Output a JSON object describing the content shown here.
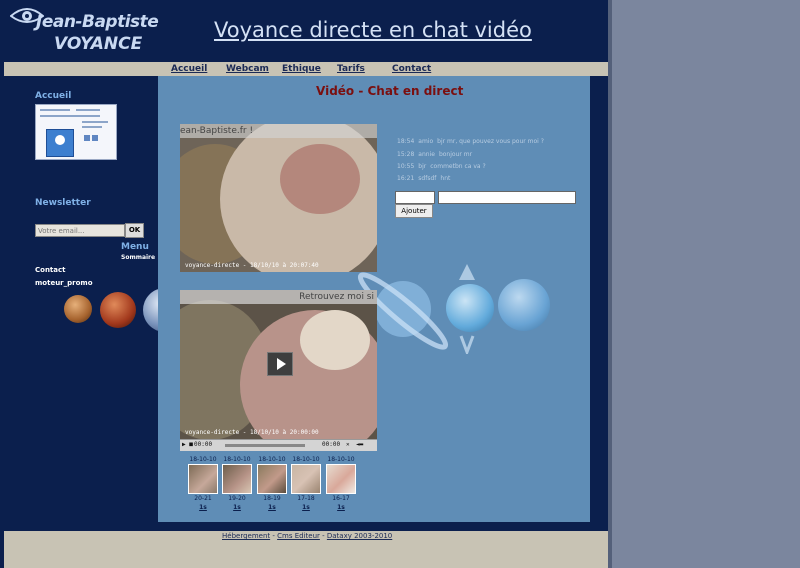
{
  "header": {
    "logo_name": "Jean-Baptiste",
    "logo_sub": "VOYANCE",
    "site_title": "Voyance directe en chat vidéo"
  },
  "nav": {
    "items": [
      "Accueil",
      "Webcam",
      "Ethique",
      "Tarifs",
      "Contact"
    ]
  },
  "left": {
    "accueil_title": "Accueil",
    "newsletter_title": "Newsletter",
    "email_placeholder": "Votre email...",
    "ok_label": "OK",
    "menu_title": "Menu",
    "sommaire": "Sommaire",
    "contact": "Contact",
    "promo": "moteur_promo"
  },
  "main": {
    "title": "Vidéo - Chat en direct",
    "video1_caption": "ean-Baptiste.fr !",
    "video1_stamp": "voyance-directe - 18/10/10 à 20:07:40",
    "video2_caption": "Retrouvez moi si",
    "video2_stamp": "voyance-directe - 18/10/10 à 20:00:00",
    "controls_left": "00:00",
    "controls_right": "00:00"
  },
  "chat": {
    "messages": [
      {
        "time": "18:54",
        "name": "amio",
        "text": "bjr mr, que pouvez vous pour moi ?"
      },
      {
        "time": "15:28",
        "name": "annie",
        "text": "bonjour mr"
      },
      {
        "time": "10:55",
        "name": "bjr",
        "text": "commetbn ca va ?"
      },
      {
        "time": "16:21",
        "name": "sdfsdf",
        "text": "hnt"
      }
    ],
    "add_label": "Ajouter"
  },
  "archives": [
    {
      "date": "18-10-10",
      "hours": "20-21",
      "link": "1s"
    },
    {
      "date": "18-10-10",
      "hours": "19-20",
      "link": "1s"
    },
    {
      "date": "18-10-10",
      "hours": "18-19",
      "link": "1s"
    },
    {
      "date": "18-10-10",
      "hours": "17-18",
      "link": "1s"
    },
    {
      "date": "18-10-10",
      "hours": "16-17",
      "link": "1s"
    }
  ],
  "footer": {
    "hosting": "Hébergement",
    "sep1": " - ",
    "cms": "Cms Editeur",
    "sep2": " - ",
    "copyright": "Dataxy 2003-2010"
  },
  "colors": {
    "page_bg": "#0b1f4d",
    "main_bg": "#5f8db6",
    "bar_bg": "#c8c3b4",
    "title_red": "#7a0f0f",
    "right_margin": "#7b869e"
  }
}
